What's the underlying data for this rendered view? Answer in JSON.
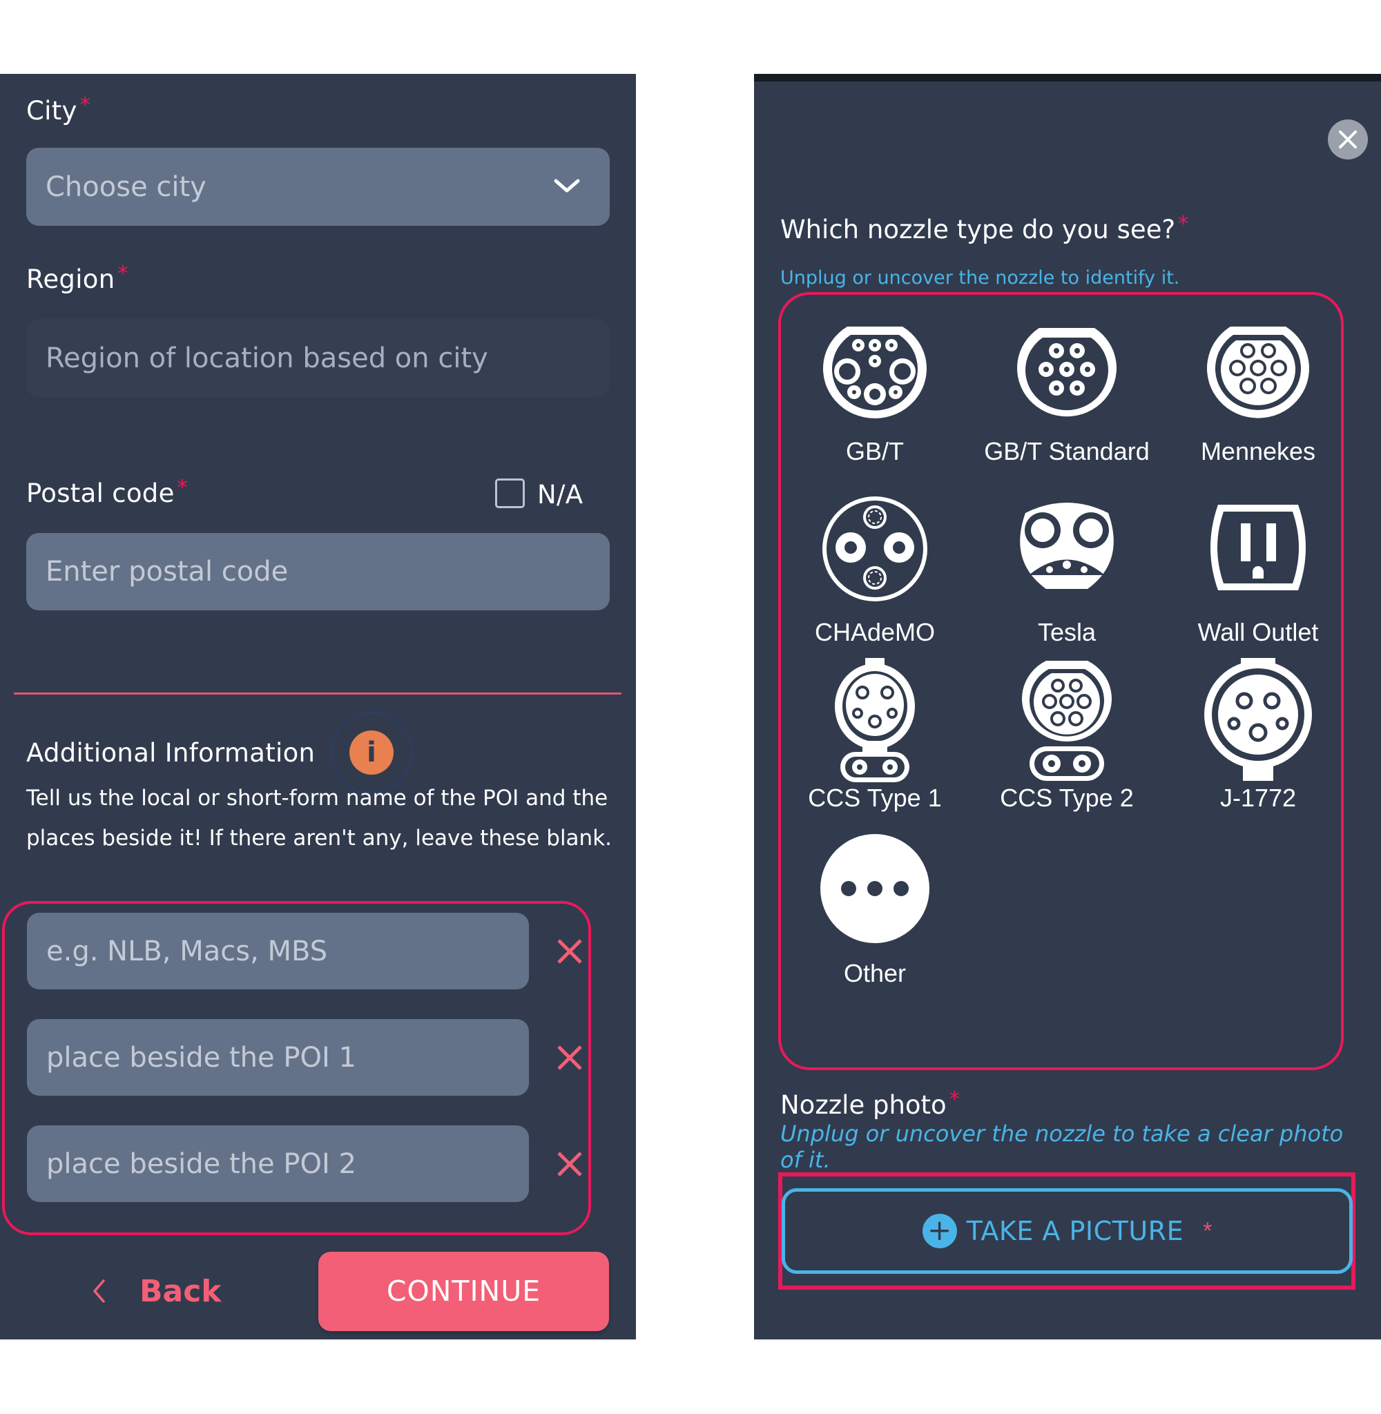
{
  "colors": {
    "panel_bg": "#313b4d",
    "input_bg": "#647289",
    "accent_red": "#e8195a",
    "button_pink": "#f25f77",
    "hint_blue": "#4ab4e8",
    "info_orange": "#e8804f"
  },
  "left": {
    "city": {
      "label": "City",
      "required_mark": "*",
      "placeholder": "Choose city",
      "icon": "chevron-down-icon"
    },
    "region": {
      "label": "Region",
      "required_mark": "*",
      "placeholder": "Region of location based on city"
    },
    "postal": {
      "label": "Postal code",
      "required_mark": "*",
      "na_label": "N/A",
      "na_checked": false,
      "placeholder": "Enter postal code"
    },
    "additional": {
      "title": "Additional Information",
      "info_icon": "info-icon",
      "info_glyph": "i",
      "description": "Tell us the local or short-form name of the POI and the places beside it! If there aren't any, leave these blank.",
      "fields": [
        {
          "placeholder": "e.g. NLB, Macs, MBS"
        },
        {
          "placeholder": "place beside the POI 1"
        },
        {
          "placeholder": "place beside the POI 2"
        }
      ]
    },
    "footer": {
      "back_label": "Back",
      "continue_label": "CONTINUE"
    }
  },
  "right": {
    "question": "Which nozzle type do you see?",
    "required_mark": "*",
    "hint": "Unplug or uncover the nozzle to identify it.",
    "nozzles": [
      {
        "label": "GB/T",
        "icon": "gbt-plug-icon"
      },
      {
        "label": "GB/T Standard",
        "icon": "gbt-standard-plug-icon"
      },
      {
        "label": "Mennekes",
        "icon": "mennekes-plug-icon"
      },
      {
        "label": "CHAdeMO",
        "icon": "chademo-plug-icon"
      },
      {
        "label": "Tesla",
        "icon": "tesla-plug-icon"
      },
      {
        "label": "Wall Outlet",
        "icon": "wall-outlet-icon"
      },
      {
        "label": "CCS Type 1",
        "icon": "ccs-type1-plug-icon"
      },
      {
        "label": "CCS Type 2",
        "icon": "ccs-type2-plug-icon"
      },
      {
        "label": "J-1772",
        "icon": "j1772-plug-icon"
      },
      {
        "label": "Other",
        "icon": "more-dots-icon"
      }
    ],
    "photo": {
      "label": "Nozzle photo",
      "required_mark": "*",
      "hint": "Unplug or uncover the nozzle to take a clear photo of it.",
      "button_label": "TAKE A PICTURE",
      "button_required_mark": "*",
      "button_icon": "plus-circle-icon",
      "button_icon_glyph": "+"
    }
  }
}
